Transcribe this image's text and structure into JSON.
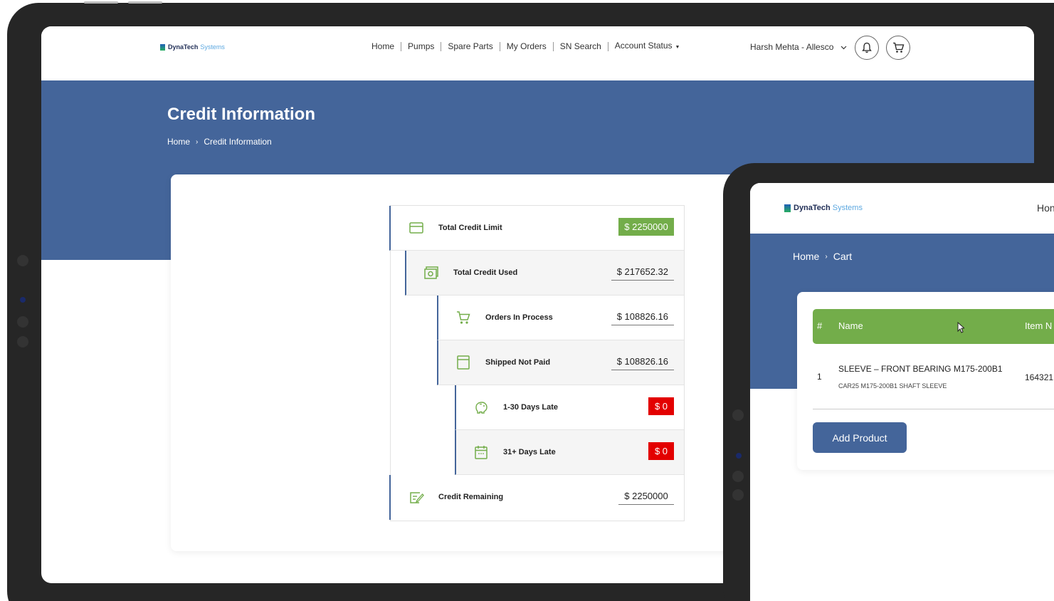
{
  "back_screen": {
    "logo": {
      "brand": "DynaTech",
      "sub": "Systems"
    },
    "nav": {
      "items": [
        "Home",
        "Pumps",
        "Spare Parts",
        "My Orders",
        "SN Search"
      ],
      "account_status": "Account Status",
      "user": "Harsh Mehta - Allesco"
    },
    "hero": {
      "title": "Credit Information",
      "breadcrumb": {
        "home": "Home",
        "current": "Credit Information"
      }
    },
    "credit": {
      "rows": [
        {
          "label": "Total Credit Limit",
          "value": "$ 2250000",
          "icon": "credit-card-icon"
        },
        {
          "label": "Total Credit Used",
          "value": "$ 217652.32",
          "icon": "cash-icon"
        },
        {
          "label": "Orders In Process",
          "value": "$ 108826.16",
          "icon": "cart-icon"
        },
        {
          "label": "Shipped Not Paid",
          "value": "$ 108826.16",
          "icon": "document-icon"
        },
        {
          "label": "1-30 Days Late",
          "value": "$ 0",
          "icon": "piggy-bank-icon"
        },
        {
          "label": "31+ Days Late",
          "value": "$ 0",
          "icon": "calendar-icon"
        },
        {
          "label": "Credit Remaining",
          "value": "$ 2250000",
          "icon": "edit-note-icon"
        }
      ],
      "colors": {
        "green": "#73ad4a",
        "red": "#e30000",
        "blue": "#44659a"
      }
    }
  },
  "front_screen": {
    "logo": {
      "brand": "DynaTech",
      "sub": "Systems"
    },
    "nav_home": "Hon",
    "breadcrumb": {
      "home": "Home",
      "current": "Cart"
    },
    "table": {
      "headers": {
        "index": "#",
        "name": "Name",
        "item": "Item N"
      },
      "rows": [
        {
          "index": "1",
          "name": "SLEEVE – FRONT BEARING M175-200B1",
          "description": "CAR25 M175-200B1 SHAFT SLEEVE",
          "item_no": "164321"
        }
      ]
    },
    "add_button": "Add Product"
  }
}
